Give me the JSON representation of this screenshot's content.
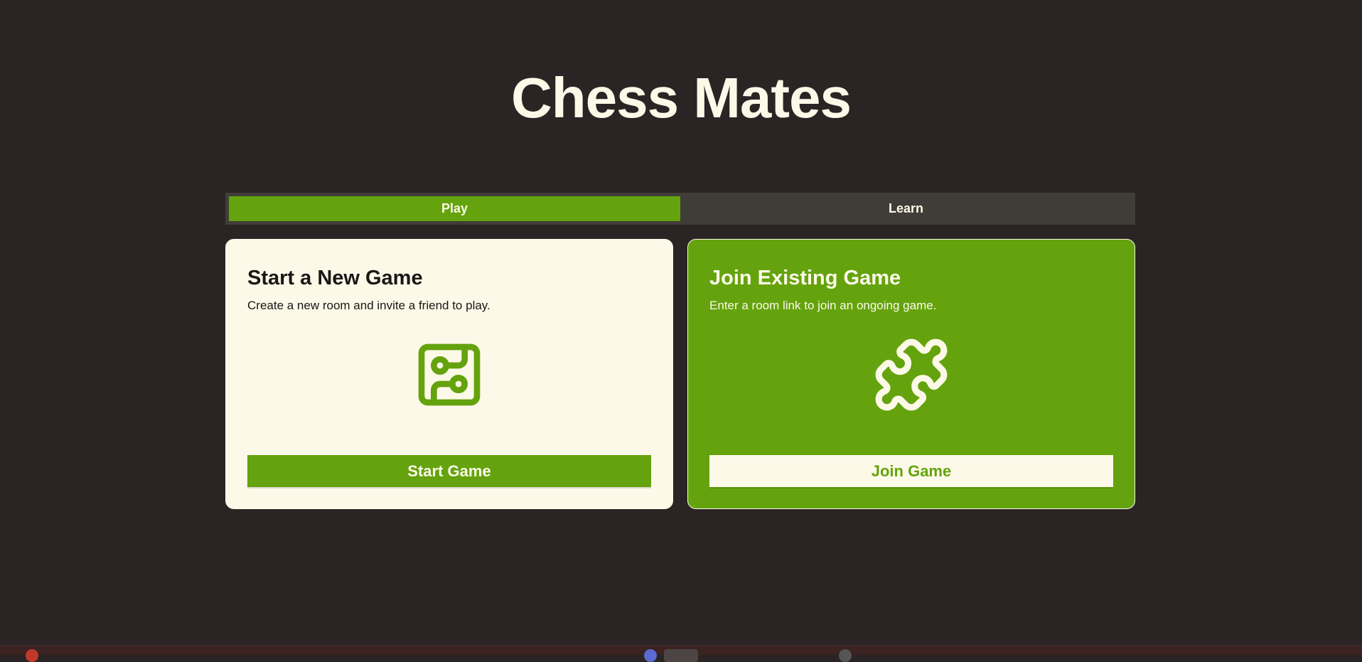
{
  "app": {
    "title": "Chess Mates"
  },
  "tabs": [
    {
      "label": "Play",
      "active": true
    },
    {
      "label": "Learn",
      "active": false
    }
  ],
  "cards": {
    "new_game": {
      "heading": "Start a New Game",
      "description": "Create a new room and invite a friend to play.",
      "icon": "circuit-board-icon",
      "button_label": "Start Game"
    },
    "join_game": {
      "heading": "Join Existing Game",
      "description": "Enter a room link to join an ongoing game.",
      "icon": "puzzle-icon",
      "button_label": "Join Game"
    }
  },
  "colors": {
    "background": "#2a2524",
    "accent": "#64a30d",
    "cream": "#fdf9e8",
    "tabbar": "#403c38"
  }
}
